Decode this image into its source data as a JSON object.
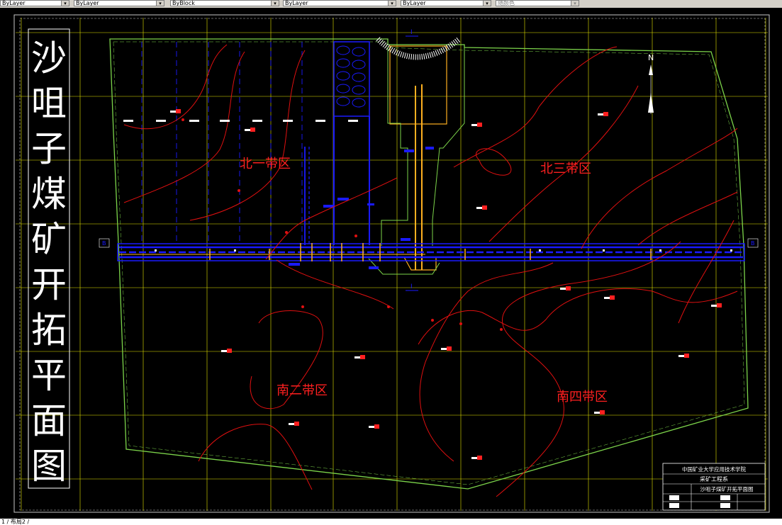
{
  "toolbar": {
    "layer_value": "ByLayer",
    "color_value": "ByLayer",
    "linetype_value": "ByBlock",
    "lineweight_value": "ByLayer",
    "plotstyle_value": "随颜色"
  },
  "drawing": {
    "vertical_title": [
      "沙",
      "咀",
      "子",
      "煤",
      "矿",
      "开",
      "拓",
      "平",
      "面",
      "图"
    ],
    "zones": {
      "north1": "北一带区",
      "north3": "北三带区",
      "south2": "南二带区",
      "south4": "南四带区"
    },
    "north_arrow": "N",
    "section_mark_roman": "I",
    "section_mark_b": "B",
    "title_block": {
      "school": "中国矿业大学应用技术学院",
      "department": "采矿工程系",
      "drawing_name": "沙咀子煤矿开拓平面图"
    }
  },
  "colors": {
    "background": "#000000",
    "grid": "#e6e600",
    "boundary": "#7cd44a",
    "contour": "#e01010",
    "roadway": "#1a1aff",
    "shaft": "#ffb020",
    "title_text": "#ffffff",
    "zone_label": "#ff2020"
  },
  "status": {
    "layout_tabs": "1 / 布局2 /"
  }
}
